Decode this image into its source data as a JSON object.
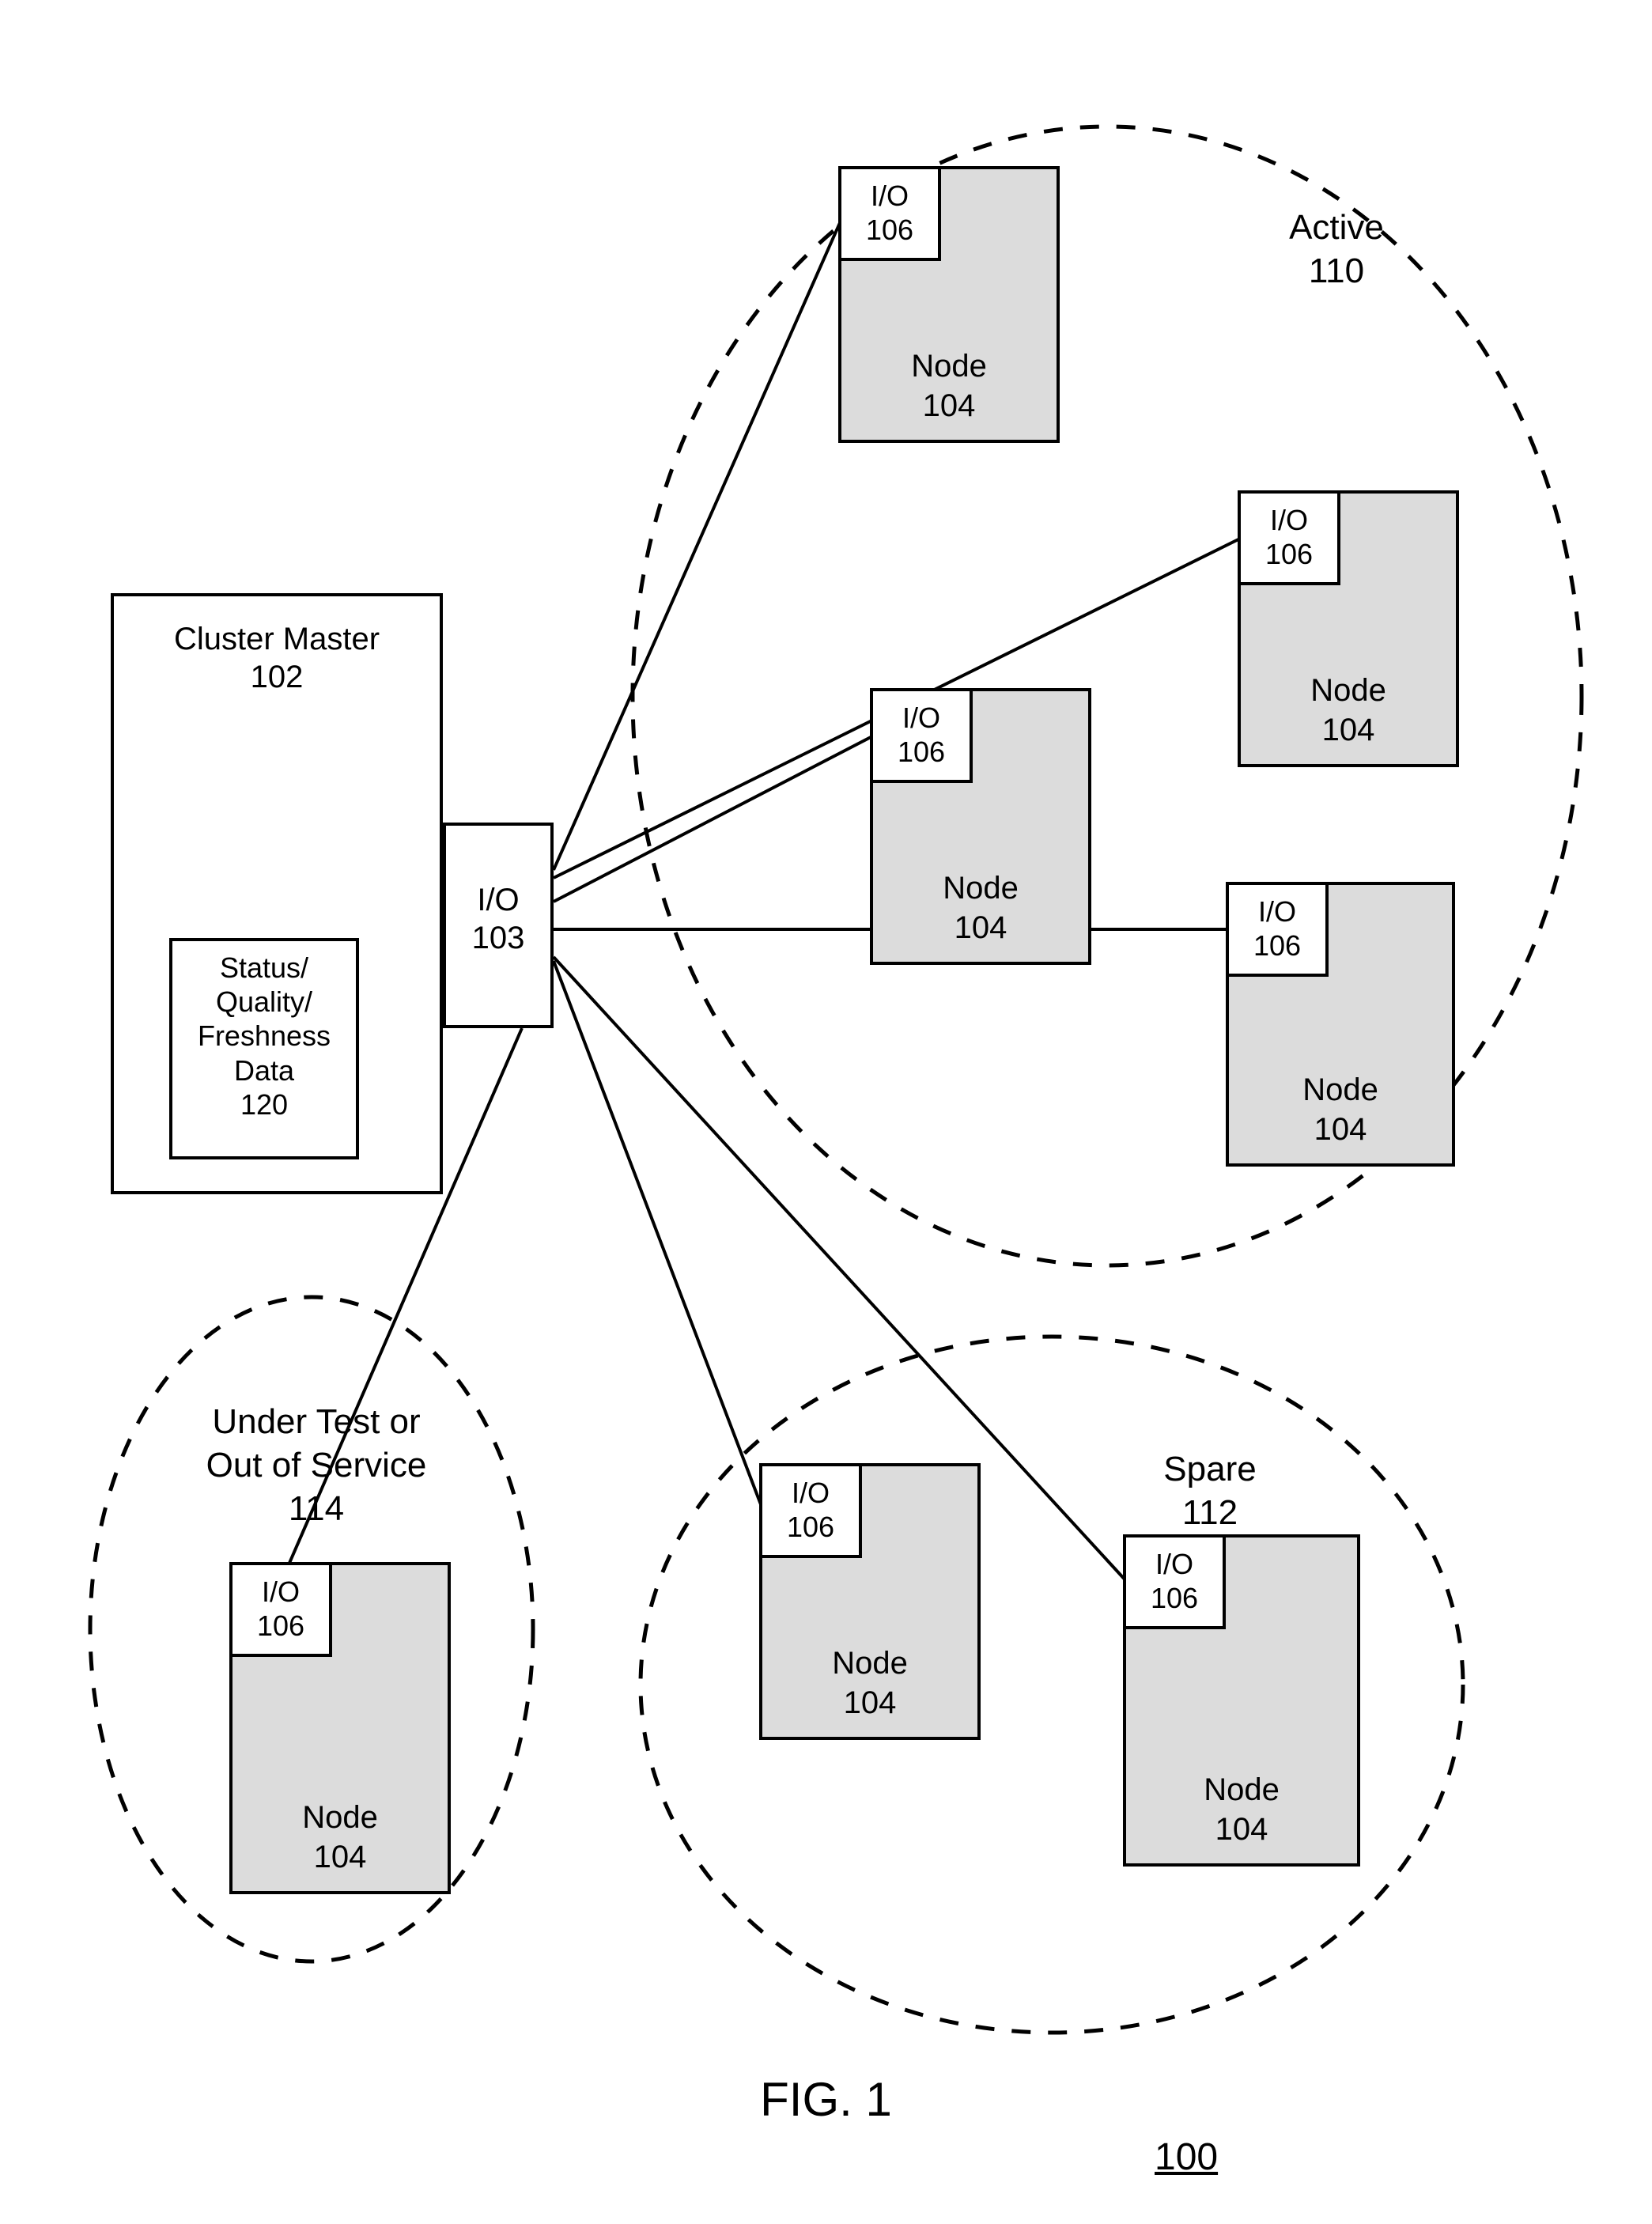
{
  "figure": {
    "caption": "FIG. 1",
    "ref": "100"
  },
  "clusterMaster": {
    "title": "Cluster Master",
    "ref": "102"
  },
  "clusterMasterSub": {
    "line1": "Status/",
    "line2": "Quality/",
    "line3": "Freshness",
    "line4": "Data",
    "ref": "120"
  },
  "clusterMasterIO": {
    "label": "I/O",
    "ref": "103"
  },
  "groups": {
    "active": {
      "label": "Active",
      "ref": "110"
    },
    "spare": {
      "label": "Spare",
      "ref": "112"
    },
    "under": {
      "line1": "Under Test or",
      "line2": "Out of Service",
      "ref": "114"
    }
  },
  "nodes": {
    "a1": {
      "io": "I/O",
      "ioRef": "106",
      "label": "Node",
      "ref": "104"
    },
    "a2": {
      "io": "I/O",
      "ioRef": "106",
      "label": "Node",
      "ref": "104"
    },
    "a3": {
      "io": "I/O",
      "ioRef": "106",
      "label": "Node",
      "ref": "104"
    },
    "a4": {
      "io": "I/O",
      "ioRef": "106",
      "label": "Node",
      "ref": "104"
    },
    "s1": {
      "io": "I/O",
      "ioRef": "106",
      "label": "Node",
      "ref": "104"
    },
    "s2": {
      "io": "I/O",
      "ioRef": "106",
      "label": "Node",
      "ref": "104"
    },
    "u1": {
      "io": "I/O",
      "ioRef": "106",
      "label": "Node",
      "ref": "104"
    }
  }
}
